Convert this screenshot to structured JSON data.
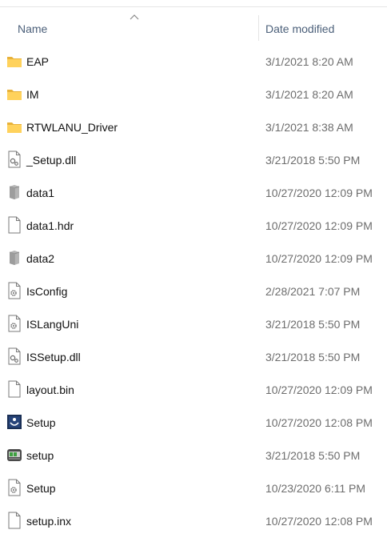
{
  "header": {
    "name_label": "Name",
    "date_label": "Date modified",
    "sort": "ascending"
  },
  "files": [
    {
      "icon": "folder-icon",
      "name": "EAP",
      "date": "3/1/2021 8:20 AM"
    },
    {
      "icon": "folder-icon",
      "name": "IM",
      "date": "3/1/2021 8:20 AM"
    },
    {
      "icon": "folder-icon",
      "name": "RTWLANU_Driver",
      "date": "3/1/2021 8:38 AM"
    },
    {
      "icon": "dll-file-icon",
      "name": "_Setup.dll",
      "date": "3/21/2018 5:50 PM"
    },
    {
      "icon": "cabinet-file-icon",
      "name": "data1",
      "date": "10/27/2020 12:09 PM"
    },
    {
      "icon": "blank-file-icon",
      "name": "data1.hdr",
      "date": "10/27/2020 12:09 PM"
    },
    {
      "icon": "cabinet-file-icon",
      "name": "data2",
      "date": "10/27/2020 12:09 PM"
    },
    {
      "icon": "settings-file-icon",
      "name": "IsConfig",
      "date": "2/28/2021 7:07 PM"
    },
    {
      "icon": "settings-file-icon",
      "name": "ISLangUni",
      "date": "3/21/2018 5:50 PM"
    },
    {
      "icon": "dll-file-icon",
      "name": "ISSetup.dll",
      "date": "3/21/2018 5:50 PM"
    },
    {
      "icon": "blank-file-icon",
      "name": "layout.bin",
      "date": "10/27/2020 12:09 PM"
    },
    {
      "icon": "setup-app-icon",
      "name": "Setup",
      "date": "10/27/2020 12:08 PM"
    },
    {
      "icon": "installer-app-icon",
      "name": "setup",
      "date": "3/21/2018 5:50 PM"
    },
    {
      "icon": "settings-file-icon",
      "name": "Setup",
      "date": "10/23/2020 6:11 PM"
    },
    {
      "icon": "blank-file-icon",
      "name": "setup.inx",
      "date": "10/27/2020 12:08 PM"
    }
  ]
}
